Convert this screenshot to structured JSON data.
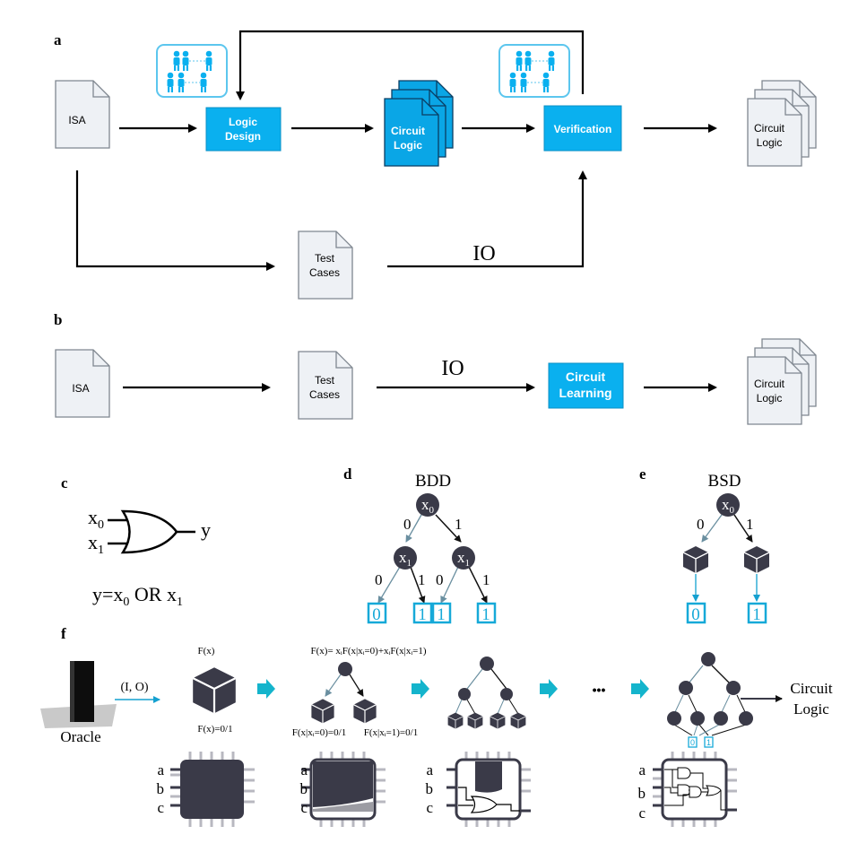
{
  "panels": {
    "a": {
      "label": "a",
      "isa": "ISA",
      "logic_design": [
        "Logic",
        "Design"
      ],
      "circuit_logic_blue": [
        "Circuit",
        "Logic"
      ],
      "verification": "Verification",
      "circuit_logic_out": [
        "Circuit",
        "Logic"
      ],
      "test_cases": [
        "Test",
        "Cases"
      ],
      "io": "IO"
    },
    "b": {
      "label": "b",
      "isa": "ISA",
      "test_cases": [
        "Test",
        "Cases"
      ],
      "io": "IO",
      "circuit_learning": [
        "Circuit",
        "Learning"
      ],
      "circuit_logic_out": [
        "Circuit",
        "Logic"
      ]
    },
    "c": {
      "label": "c",
      "in0": "x",
      "in0_sub": "0",
      "in1": "x",
      "in1_sub": "1",
      "out": "y",
      "eq_pre": "y=x",
      "eq_sub0": "0",
      "eq_mid": " OR x",
      "eq_sub1": "1"
    },
    "d": {
      "label": "d",
      "title": "BDD",
      "root": "x",
      "root_sub": "0",
      "child": "x",
      "child_sub": "1",
      "edge0": "0",
      "edge1": "1",
      "leaves": [
        "0",
        "1",
        "1",
        "1"
      ]
    },
    "e": {
      "label": "e",
      "title": "BSD",
      "root": "x",
      "root_sub": "0",
      "edge0": "0",
      "edge1": "1",
      "leaves": [
        "0",
        "1"
      ]
    },
    "f": {
      "label": "f",
      "oracle": "Oracle",
      "io_pair": "(I, O)",
      "fx": "F(x)",
      "fx_val": "F(x)=0/1",
      "shannon": "F(x)= xᵢF(x|xᵢ=0)+xᵢF(x|xᵢ=1)",
      "cof0": "F(x|xᵢ=0)=0/1",
      "cof1": "F(x|xᵢ=1)=0/1",
      "ellipsis": "•••",
      "circuit_logic": [
        "Circuit",
        "Logic"
      ],
      "leaf0": "0",
      "leaf1": "1",
      "pins": [
        "a",
        "b",
        "c"
      ]
    }
  },
  "colors": {
    "accent": "#0ab0ef",
    "arrow_teal": "#14b4cc",
    "node": "#3a3a48"
  }
}
